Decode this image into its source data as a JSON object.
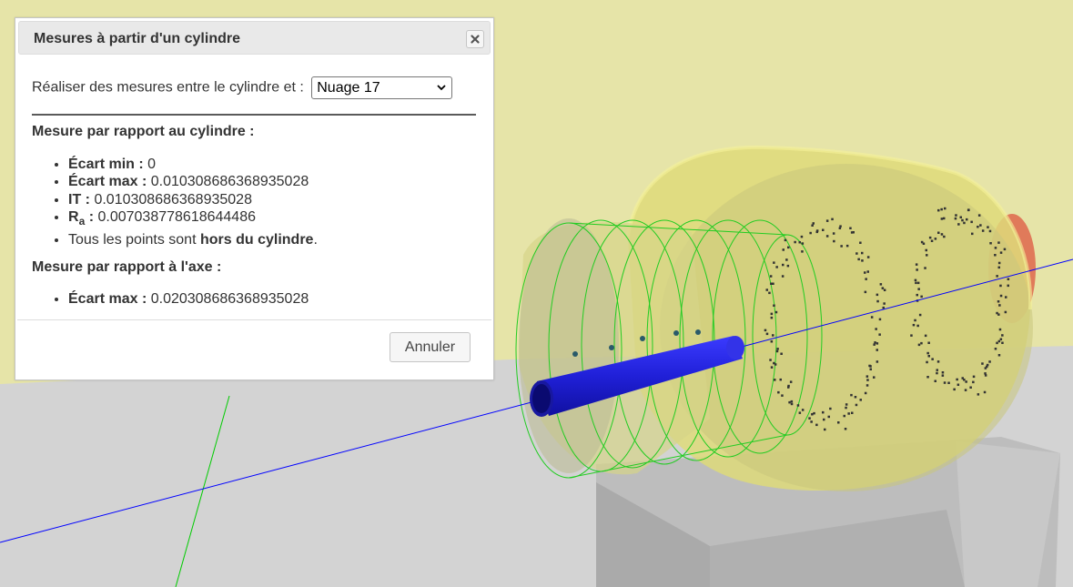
{
  "dialog": {
    "title": "Mesures à partir d'un cylindre",
    "select_label": "Réaliser des mesures entre le cylindre et :",
    "select_value": "Nuage 17",
    "section1_title": "Mesure par rapport au cylindre :",
    "section1_items": [
      {
        "label": "Écart min :",
        "value": "0"
      },
      {
        "label": "Écart max :",
        "value": "0.010308686368935028"
      },
      {
        "label": "IT :",
        "value": "0.010308686368935028"
      },
      {
        "label_main": "R",
        "label_sub": "a",
        "label_suffix": " :",
        "value": "0.007038778618644486"
      },
      {
        "text_before": "Tous les points sont ",
        "text_bold": "hors du cylindre",
        "text_after": "."
      }
    ],
    "section2_title": "Mesure par rapport à l'axe :",
    "section2_items": [
      {
        "label": "Écart max :",
        "value": "0.020308686368935028"
      }
    ],
    "cancel_label": "Annuler"
  },
  "scene": {
    "background_color": "#e6e4a8",
    "floor_color": "#d3d3d3",
    "axis_x_color": "#0000ff",
    "axis_y_color": "#00cc00",
    "cylinder_color": "#2424e0",
    "ghost_color": "#f2ee55"
  }
}
